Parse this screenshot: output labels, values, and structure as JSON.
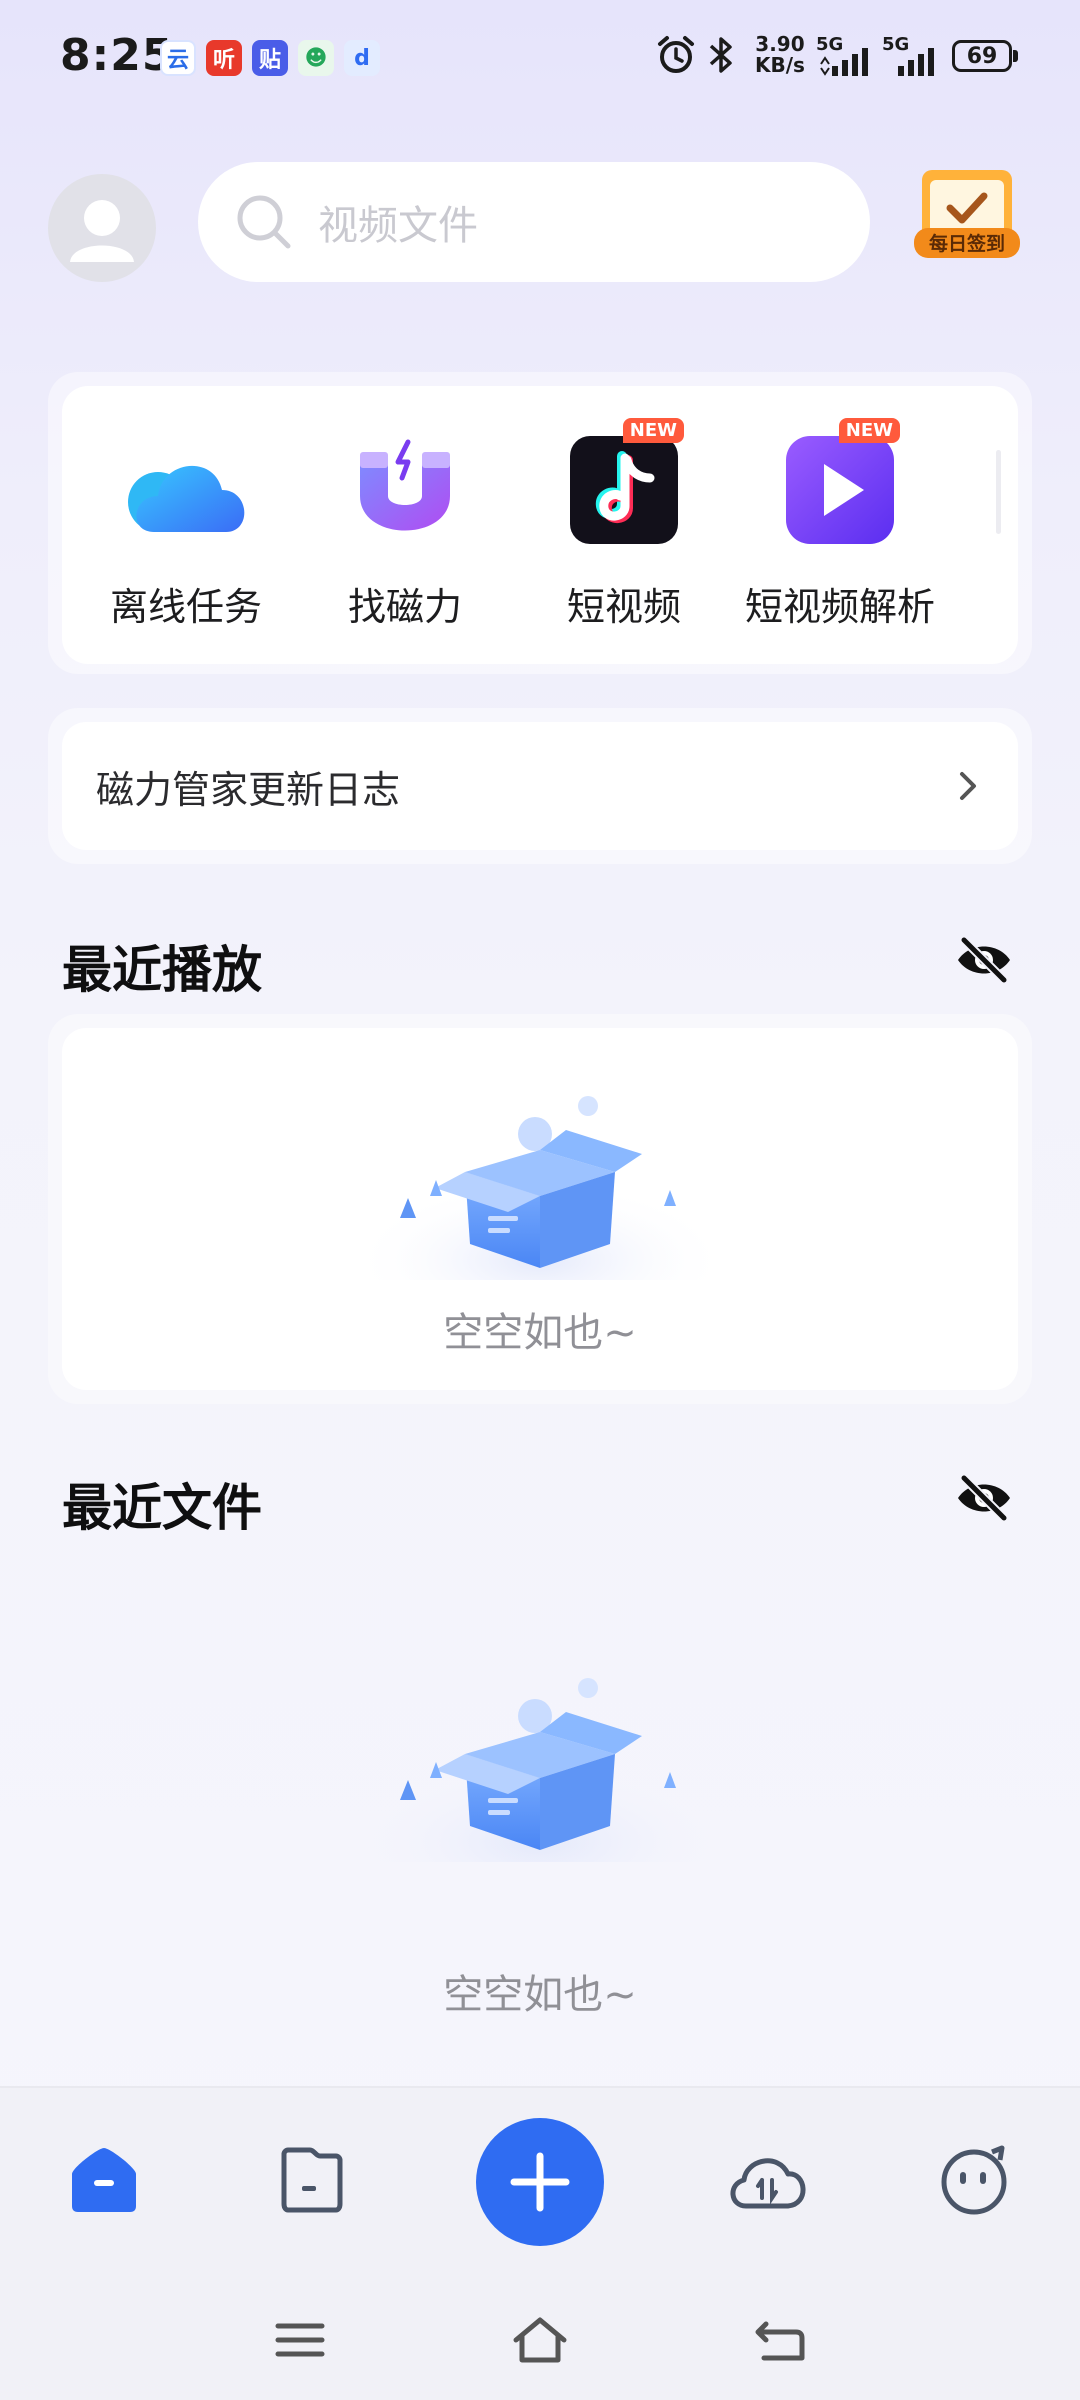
{
  "status_bar": {
    "time": "8:25",
    "net_speed_value": "3.90",
    "net_speed_unit": "KB/s",
    "signal1_label": "5G",
    "signal2_label": "5G",
    "battery": "69",
    "notification_icons": [
      "cloud-app-icon",
      "listen-app-icon",
      "tieba-app-icon",
      "game-app-icon",
      "iqiyi-app-icon"
    ],
    "notification_texts": [
      "云",
      "听",
      "贴",
      "☻",
      "d"
    ]
  },
  "header": {
    "search_placeholder": "视频文件",
    "checkin_label": "每日签到"
  },
  "quick_actions": [
    {
      "label": "离线任务",
      "icon": "cloud-icon",
      "new": false
    },
    {
      "label": "找磁力",
      "icon": "magnet-icon",
      "new": false
    },
    {
      "label": "短视频",
      "icon": "tiktok-icon",
      "new": true
    },
    {
      "label": "短视频解析",
      "icon": "play-icon",
      "new": true
    }
  ],
  "new_badge": "NEW",
  "update_log": {
    "label": "磁力管家更新日志"
  },
  "recent_play": {
    "title": "最近播放",
    "empty_text": "空空如也~"
  },
  "recent_files": {
    "title": "最近文件",
    "empty_text": "空空如也~"
  },
  "bottom_nav": [
    "home-icon",
    "files-icon",
    "add-icon",
    "cloud-transfer-icon",
    "profile-icon"
  ],
  "colors": {
    "accent": "#2f6cf2",
    "badge": "#ff5a3c"
  }
}
